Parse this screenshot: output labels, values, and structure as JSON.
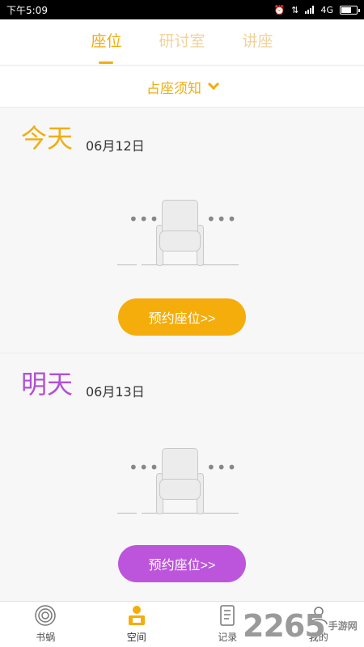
{
  "status_bar": {
    "time": "下午5:09",
    "network": "4G"
  },
  "tabs": [
    {
      "label": "座位",
      "active": true
    },
    {
      "label": "研讨室",
      "active": false
    },
    {
      "label": "讲座",
      "active": false
    }
  ],
  "notice": {
    "label": "占座须知"
  },
  "days": [
    {
      "title": "今天",
      "date": "06月12日",
      "title_color": "#f0ae12",
      "button_label": "预约座位>>",
      "button_color": "#f5ad0c"
    },
    {
      "title": "明天",
      "date": "06月13日",
      "title_color": "#b14fd5",
      "button_label": "预约座位>>",
      "button_color": "#bc55db"
    }
  ],
  "bottom_nav": [
    {
      "label": "书蜗",
      "icon": "snail-shell-icon",
      "active": false
    },
    {
      "label": "空间",
      "icon": "reading-person-icon",
      "active": true
    },
    {
      "label": "记录",
      "icon": "document-icon",
      "active": false
    },
    {
      "label": "我的",
      "icon": "user-icon",
      "active": false
    }
  ],
  "watermark": {
    "number": "2265",
    "site": "手游网"
  },
  "colors": {
    "accent": "#f0ae12",
    "accent_light": "#f0d39b",
    "purple": "#bc55db"
  }
}
